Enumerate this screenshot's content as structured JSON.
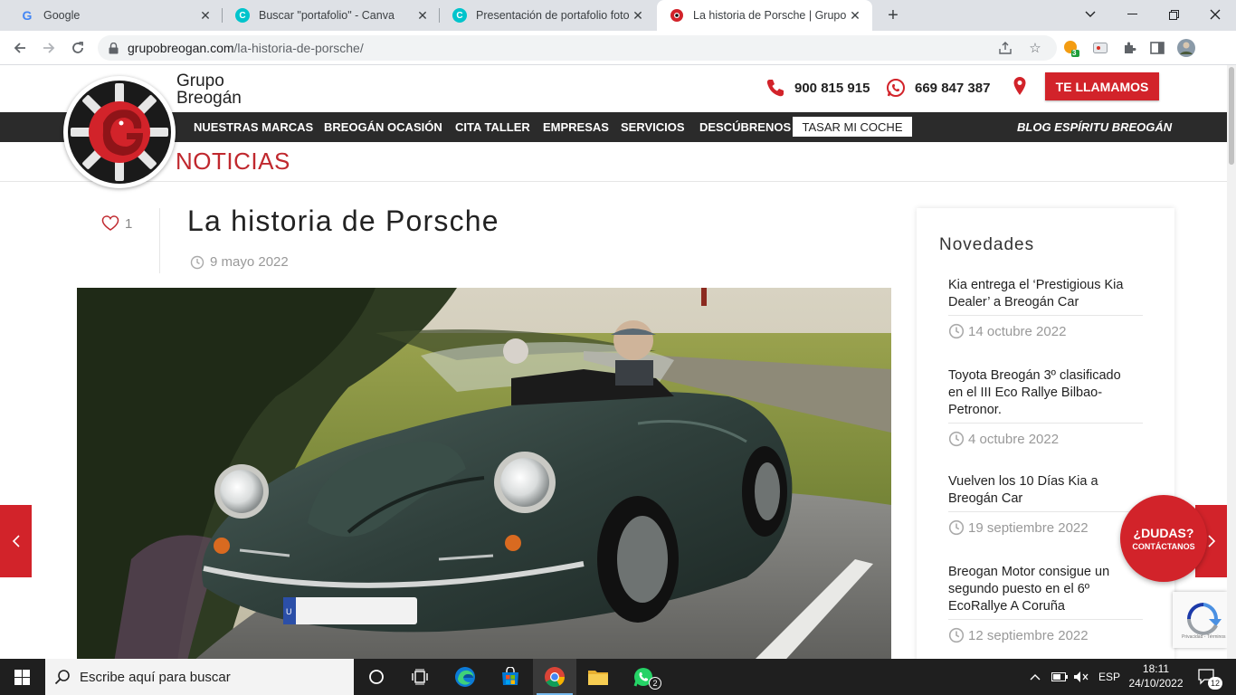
{
  "browser": {
    "tabs": [
      {
        "title": "Google"
      },
      {
        "title": "Buscar \"portafolio\" - Canva"
      },
      {
        "title": "Presentación de portafolio fotográfico"
      },
      {
        "title": "La historia de Porsche | Grupo Breogán"
      }
    ],
    "url_domain": "grupobreogan.com",
    "url_path": "/la-historia-de-porsche/",
    "extension_badge": "3"
  },
  "site": {
    "logo_line1": "Grupo",
    "logo_line2": "Breogán",
    "phone_1": "900 815 915",
    "phone_2": "669 847 387",
    "call_me_label": "TE LLAMAMOS",
    "nav": [
      {
        "label": "NUESTRAS MARCAS"
      },
      {
        "label": "BREOGÁN OCASIÓN"
      },
      {
        "label": "CITA TALLER"
      },
      {
        "label": "EMPRESAS"
      },
      {
        "label": "SERVICIOS"
      },
      {
        "label": "DESCÚBRENOS"
      }
    ],
    "nav_tasar": "TASAR MI COCHE",
    "nav_blog": "BLOG ESPÍRITU BREOGÁN",
    "section_title": "NOTICIAS"
  },
  "post": {
    "likes": "1",
    "title": "La historia de Porsche",
    "date": "9 mayo 2022",
    "plate": "U"
  },
  "sidebar": {
    "title": "Novedades",
    "items": [
      {
        "line1": "Kia entrega el ‘Prestigious Kia",
        "line2": "Dealer’ a Breogán Car",
        "line3": "",
        "date": "14 octubre 2022"
      },
      {
        "line1": "Toyota Breogán 3º clasificado",
        "line2": "en el III Eco Rallye Bilbao-",
        "line3": "Petronor.",
        "date": "4 octubre 2022"
      },
      {
        "line1": "Vuelven los 10 Días Kia a",
        "line2": "Breogán Car",
        "line3": "",
        "date": "19 septiembre 2022"
      },
      {
        "line1": "Breogan Motor consigue un",
        "line2": "segundo puesto en el 6º",
        "line3": "EcoRallye A Coruña",
        "date": "12 septiembre 2022"
      }
    ]
  },
  "widgets": {
    "dudas_main": "¿DUDAS?",
    "dudas_sub": "CONTÁCTANOS",
    "recaptcha_text": "Privacidad - Términos"
  },
  "taskbar": {
    "search_placeholder": "Escribe aquí para buscar",
    "whatsapp_badge": "2",
    "language": "ESP",
    "time": "18:11",
    "date": "24/10/2022",
    "notifications": "12"
  },
  "colors": {
    "brand_red": "#d2232a",
    "nav_dark": "#2b2b2b",
    "section_red": "#c0282e"
  }
}
